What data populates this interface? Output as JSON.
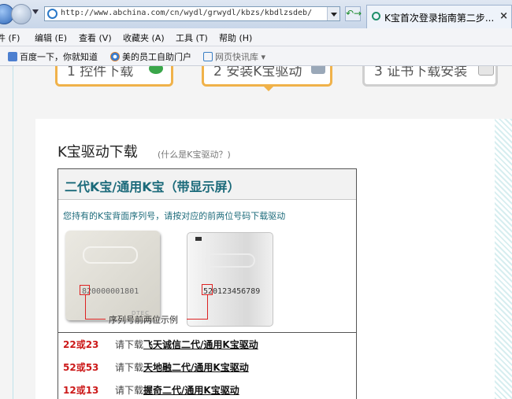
{
  "browser": {
    "address_url": "http://www.abchina.com/cn/wydl/grwydl/kbzs/kbdlzsdeb/",
    "tab_title": "K宝首次登录指南第二步...",
    "tab_close": "×",
    "refresh_glyph": "↶→",
    "menu": [
      "件 (F)",
      "编辑 (E)",
      "查看 (V)",
      "收藏夹 (A)",
      "工具 (T)",
      "帮助 (H)"
    ],
    "favorites": [
      "百度一下，你就知道",
      "美的员工自助门户",
      "网页快讯库 ▾"
    ]
  },
  "steps": [
    {
      "num": "1",
      "label": "控件下载"
    },
    {
      "num": "2",
      "label": "安装K宝驱动"
    },
    {
      "num": "3",
      "label": "证书下载安装"
    }
  ],
  "page": {
    "heading": "K宝驱动下载",
    "what_is": "(什么是K宝驱动？)",
    "box_title": "二代K宝/通用K宝（带显示屏）",
    "instruction": "您持有的K宝背面序列号，请按对应的前两位号码下载驱动",
    "device1_serial": "820000001801",
    "device1_brand": "DTEC",
    "device2_serial": "520123456789",
    "serial_hint": "序列号前两位示例",
    "rows": [
      {
        "code": "22或23",
        "prefix": "请下载",
        "link": "飞天诚信二代/通用K宝驱动"
      },
      {
        "code": "52或53",
        "prefix": "请下载",
        "link": "天地融二代/通用K宝驱动"
      },
      {
        "code": "12或13",
        "prefix": "请下载",
        "link": "握奇二代/通用K宝驱动"
      }
    ]
  }
}
